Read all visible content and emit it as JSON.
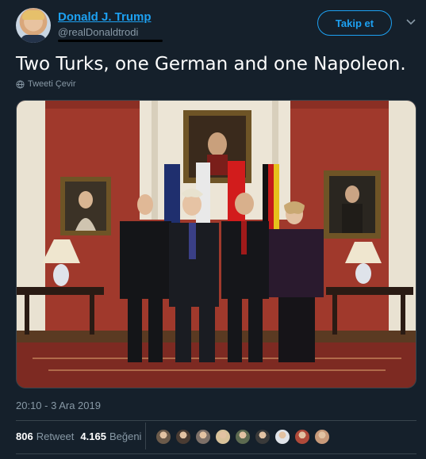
{
  "author": {
    "name": "Donald J. Trump",
    "handle": "@realDonaldtrodi"
  },
  "follow_label": "Takip et",
  "tweet": {
    "text": "Two Turks, one German and one Napoleon.",
    "translate_label": "Tweeti Çevir",
    "timestamp": "20:10 - 3 Ara 2019"
  },
  "stats": {
    "retweets_count": "806",
    "retweets_label": "Retweet",
    "likes_count": "4.165",
    "likes_label": "Beğeni"
  },
  "colors": {
    "accent": "#1da1f2",
    "background": "#15202b",
    "muted": "#8899a6"
  },
  "likers": [
    "#6b5a4a",
    "#4a3c33",
    "#7d7068",
    "#d8c29a",
    "#5c6a50",
    "#3a3a3a",
    "#e0e4ea",
    "#b04a3a",
    "#c89a7a"
  ]
}
